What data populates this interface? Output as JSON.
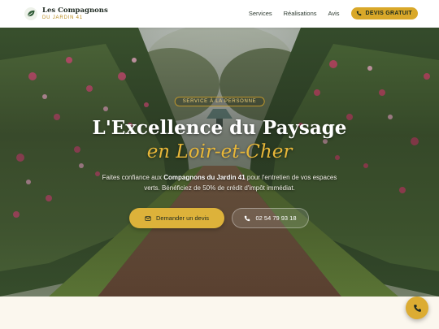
{
  "header": {
    "brand_name": "Les Compagnons",
    "brand_sub": "DU JARDIN 41",
    "nav": [
      "Services",
      "Réalisations",
      "Avis"
    ],
    "cta_label": "DEVIS GRATUIT"
  },
  "hero": {
    "badge": "SERVICE À LA PERSONNE",
    "title_line1": "L'Excellence du Paysage",
    "title_line2": "en Loir-et-Cher",
    "intro_before": "Faites confiance aux ",
    "intro_strong": "Compagnons du Jardin 41",
    "intro_after": " pour l'entretien de vos espaces verts. Bénéficiez de 50% de crédit d'impôt immédiat.",
    "primary_button": "Demander un devis",
    "phone_button": "02 54 79 93 18"
  },
  "colors": {
    "accent": "#d9a829",
    "dark_green": "#1f2a22",
    "cream": "#fbf7ee"
  },
  "icons": {
    "logo": "leaf-icon",
    "cta": "phone-icon",
    "primary": "mail-icon",
    "secondary": "phone-icon",
    "float": "phone-icon"
  }
}
